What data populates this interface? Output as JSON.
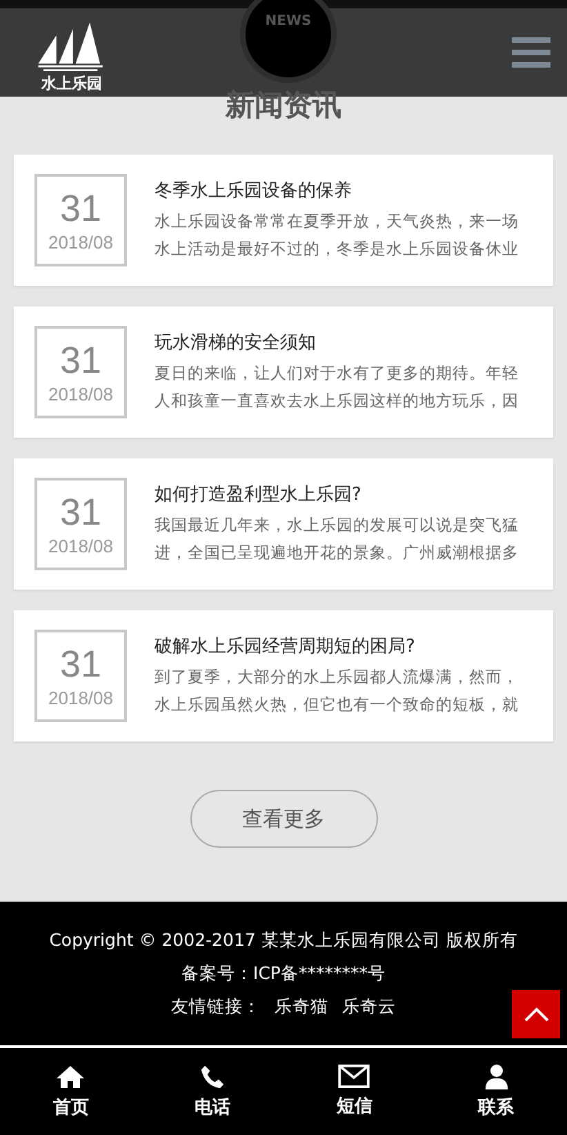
{
  "header": {
    "logo_text": "水上乐园",
    "badge": "NEWS"
  },
  "section_title": "新闻资讯",
  "news": [
    {
      "day": "31",
      "month": "2018/08",
      "title": "冬季水上乐园设备的保养",
      "summary": "水上乐园设备常常在夏季开放，天气炎热，来一场水上活动是最好不过的，冬季是水上乐园设备休业"
    },
    {
      "day": "31",
      "month": "2018/08",
      "title": "玩水滑梯的安全须知",
      "summary": "夏日的来临，让人们对于水有了更多的期待。年轻人和孩童一直喜欢去水上乐园这样的地方玩乐，因"
    },
    {
      "day": "31",
      "month": "2018/08",
      "title": "如何打造盈利型水上乐园?",
      "summary": "我国最近几年来，水上乐园的发展可以说是突飞猛进，全国已呈现遍地开花的景象。广州威潮根据多"
    },
    {
      "day": "31",
      "month": "2018/08",
      "title": "破解水上乐园经营周期短的困局?",
      "summary": "到了夏季，大部分的水上乐园都人流爆满，然而，水上乐园虽然火热，但它也有一个致命的短板，就"
    }
  ],
  "more_button": "查看更多",
  "footer": {
    "copyright": "Copyright © 2002-2017 某某水上乐园有限公司 版权所有",
    "icp": "备案号：ICP备********号",
    "links_label": "友情链接：",
    "links": [
      "乐奇猫",
      "乐奇云"
    ]
  },
  "bottom_nav": [
    {
      "kind": "home",
      "label": "首页"
    },
    {
      "kind": "phone",
      "label": "电话"
    },
    {
      "kind": "mail",
      "label": "短信"
    },
    {
      "kind": "person",
      "label": "联系"
    }
  ]
}
